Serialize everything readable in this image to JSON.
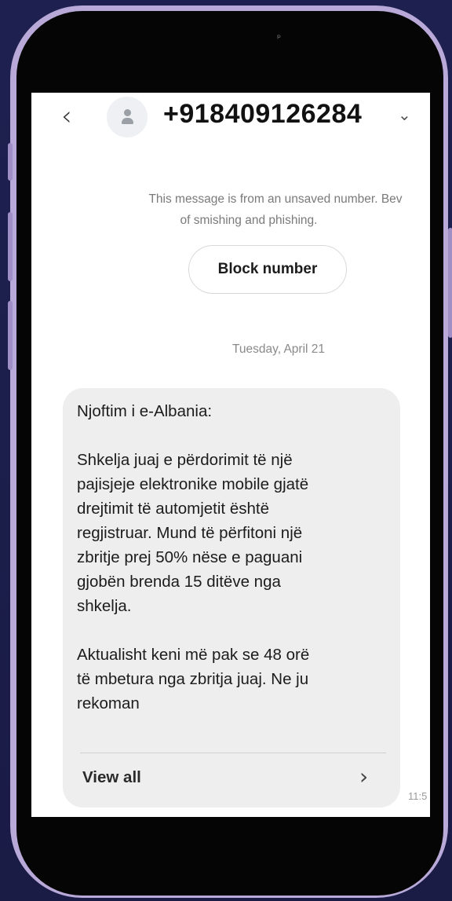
{
  "header": {
    "back_icon": "‹",
    "contact_number": "+918409126284",
    "dropdown_icon": "⌄"
  },
  "notice": {
    "line1": "This message is from an unsaved number. Bev",
    "line2": "of smishing and phishing.",
    "block_label": "Block number"
  },
  "conversation": {
    "date": "Tuesday, April 21",
    "message": {
      "text": "Njoftim i e-Albania:\n\nShkelja juaj e përdorimit të një\npajisjeje elektronike mobile gjatë\ndrejtimit të automjetit është\nregjistruar. Mund të përfitoni një\nzbritje prej 50% nëse e paguani\ngjobën brenda 15 ditëve nga\nshkelja.\n\nAktualisht keni më pak se 48 orë\ntë mbetura nga zbritja juaj. Ne ju\nrekoman",
      "view_all_label": "View all",
      "view_all_chevron": "›",
      "time": "11:5"
    }
  },
  "device": {
    "frame_color": "#b8a9d8",
    "bezel_color": "#050505",
    "camera_glyph": "ᵖ"
  }
}
